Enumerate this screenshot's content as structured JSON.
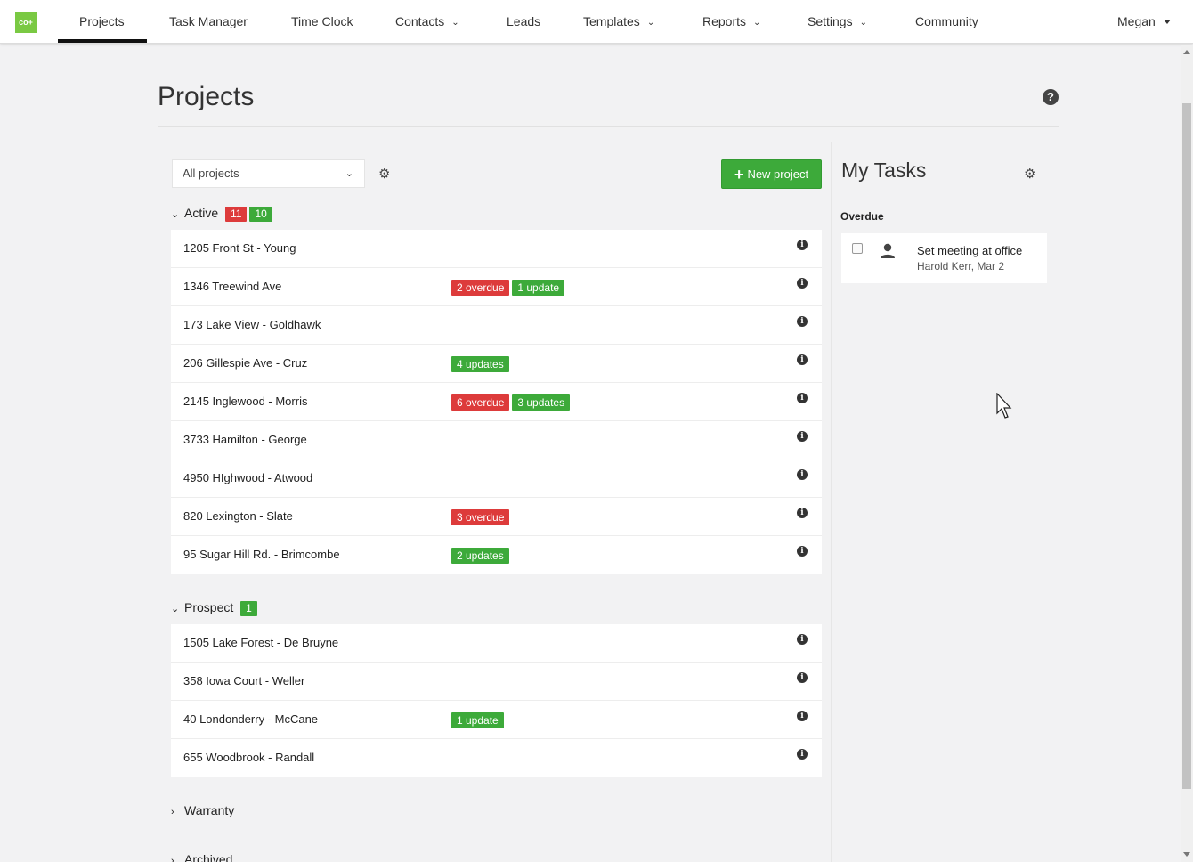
{
  "logo": {
    "text": "co+"
  },
  "nav": {
    "items": [
      {
        "label": "Projects",
        "dropdown": false,
        "active": true
      },
      {
        "label": "Task Manager",
        "dropdown": false
      },
      {
        "label": "Time Clock",
        "dropdown": false
      },
      {
        "label": "Contacts",
        "dropdown": true
      },
      {
        "label": "Leads",
        "dropdown": false
      },
      {
        "label": "Templates",
        "dropdown": true
      },
      {
        "label": "Reports",
        "dropdown": true
      },
      {
        "label": "Settings",
        "dropdown": true
      },
      {
        "label": "Community",
        "dropdown": false
      }
    ],
    "user": "Megan"
  },
  "page": {
    "title": "Projects",
    "help_icon": "question-circle-icon"
  },
  "controls": {
    "filter_value": "All projects",
    "new_project_label": "New project"
  },
  "groups": {
    "active": {
      "label": "Active",
      "counts": [
        {
          "value": "11",
          "color": "red"
        },
        {
          "value": "10",
          "color": "green"
        }
      ],
      "projects": [
        {
          "name": "1205 Front St - Young",
          "badges": []
        },
        {
          "name": "1346 Treewind Ave",
          "badges": [
            {
              "text": "2 overdue",
              "color": "red"
            },
            {
              "text": "1 update",
              "color": "green"
            }
          ]
        },
        {
          "name": "173 Lake View - Goldhawk",
          "badges": []
        },
        {
          "name": "206 Gillespie Ave - Cruz",
          "badges": [
            {
              "text": "4 updates",
              "color": "green"
            }
          ]
        },
        {
          "name": "2145 Inglewood - Morris",
          "badges": [
            {
              "text": "6 overdue",
              "color": "red"
            },
            {
              "text": "3 updates",
              "color": "green"
            }
          ]
        },
        {
          "name": "3733 Hamilton - George",
          "badges": []
        },
        {
          "name": "4950 HIghwood - Atwood",
          "badges": []
        },
        {
          "name": "820 Lexington - Slate",
          "badges": [
            {
              "text": "3 overdue",
              "color": "red"
            }
          ]
        },
        {
          "name": "95 Sugar Hill Rd. - Brimcombe",
          "badges": [
            {
              "text": "2 updates",
              "color": "green"
            }
          ]
        }
      ]
    },
    "prospect": {
      "label": "Prospect",
      "counts": [
        {
          "value": "1",
          "color": "green"
        }
      ],
      "projects": [
        {
          "name": "1505 Lake Forest - De Bruyne",
          "badges": []
        },
        {
          "name": "358 Iowa Court - Weller",
          "badges": []
        },
        {
          "name": "40 Londonderry - McCane",
          "badges": [
            {
              "text": "1 update",
              "color": "green"
            }
          ]
        },
        {
          "name": "655 Woodbrook - Randall",
          "badges": []
        }
      ]
    },
    "warranty": {
      "label": "Warranty"
    },
    "archived": {
      "label": "Archived"
    }
  },
  "tasks": {
    "title": "My Tasks",
    "section_label": "Overdue",
    "items": [
      {
        "title": "Set meeting at office",
        "subtitle": "Harold Kerr, Mar 2"
      }
    ]
  },
  "colors": {
    "accent_green": "#3daa3a",
    "alert_red": "#dd3b3b",
    "logo_green": "#7ac943"
  }
}
